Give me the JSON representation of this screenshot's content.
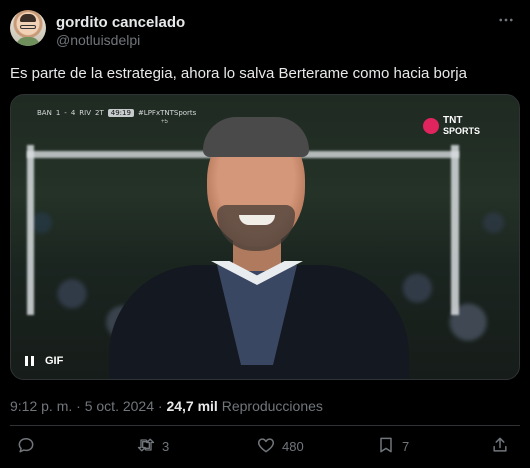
{
  "user": {
    "display_name": "gordito cancelado",
    "handle": "@notluisdelpi"
  },
  "tweet": {
    "text": "Es parte de la estrategia, ahora lo salva Berterame como hacia borja"
  },
  "media": {
    "type_badge": "GIF",
    "score_overlay": {
      "home": "BAN",
      "home_score": "1",
      "away_score": "4",
      "away": "RIV",
      "period": "2T",
      "clock": "49:19",
      "tag": "#LPFxTNTSports",
      "added": "+5"
    },
    "broadcaster_top": "TNT",
    "broadcaster_bottom": "SPORTS"
  },
  "meta": {
    "time": "9:12 p. m.",
    "separator": "·",
    "date": "5 oct. 2024",
    "views_count": "24,7 mil",
    "views_label": "Reproducciones"
  },
  "actions": {
    "reply_count": "",
    "retweet_count": "3",
    "like_count": "480",
    "bookmark_count": "7"
  },
  "icons": [
    "more-icon",
    "pause-icon",
    "reply-icon",
    "retweet-icon",
    "like-icon",
    "bookmark-icon",
    "share-icon"
  ]
}
